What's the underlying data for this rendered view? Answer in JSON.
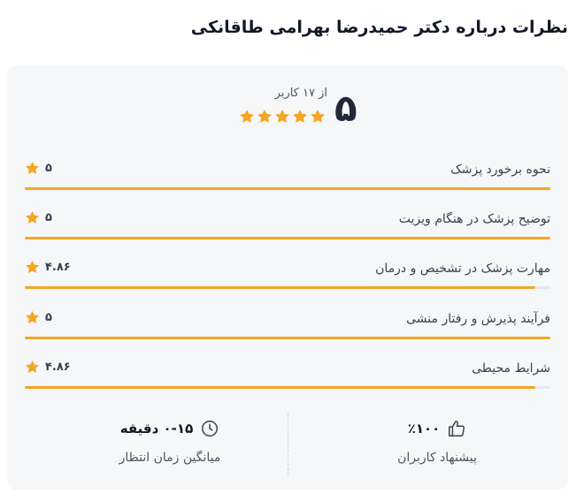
{
  "heading": "نظرات درباره دکتر حمیدرضا بهرامی طاقانکی",
  "summary": {
    "score": "۵",
    "out_of": "از ۱۷ کاربر",
    "stars": 5
  },
  "ratings": [
    {
      "label": "نحوه برخورد پزشک",
      "value": "۵",
      "fraction": 1.0
    },
    {
      "label": "توضیح پزشک در هنگام ویزیت",
      "value": "۵",
      "fraction": 1.0
    },
    {
      "label": "مهارت پزشک در تشخیص و درمان",
      "value": "۴.۸۶",
      "fraction": 0.972
    },
    {
      "label": "فرآیند پذیرش و رفتار منشی",
      "value": "۵",
      "fraction": 1.0
    },
    {
      "label": "شرایط محیطی",
      "value": "۴.۸۶",
      "fraction": 0.972
    }
  ],
  "stats": {
    "recommend_value": "٪۱۰۰",
    "recommend_caption": "پیشنهاد کاربران",
    "wait_value": "۰-۱۵ دقیقه",
    "wait_caption": "میانگین زمان انتظار"
  },
  "colors": {
    "accent": "#f5a623",
    "track": "#e5e7eb",
    "card_bg": "#f6f7f9"
  },
  "icons": {
    "star": "star-icon",
    "recommend": "thumbs-up-icon",
    "wait": "clock-icon"
  }
}
